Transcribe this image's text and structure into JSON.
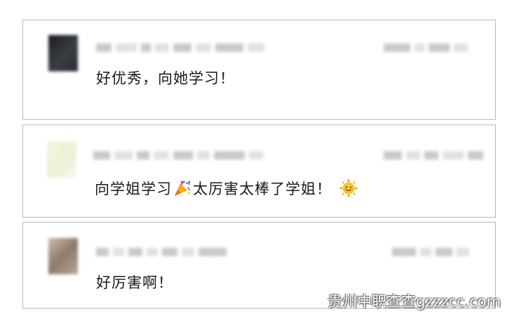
{
  "comments": [
    {
      "text": "好优秀，向她学习！"
    },
    {
      "text_before": "向学姐学习",
      "text_after": "太厉害太棒了学姐！",
      "emoji_1": "party-popper",
      "emoji_2": "sun-with-face"
    },
    {
      "text": "好厉害啊！"
    }
  ],
  "watermark": "贵州中职查查gzzzcc.com"
}
